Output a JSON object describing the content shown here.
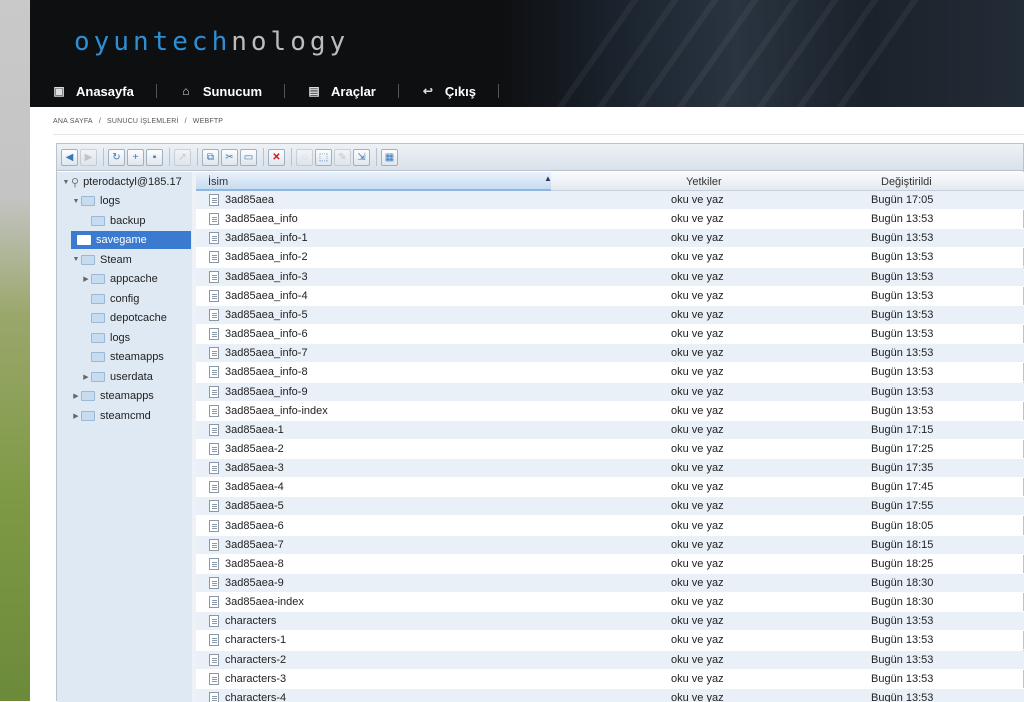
{
  "logo": {
    "part1": "oyuntech",
    "part2": "nology"
  },
  "nav": [
    {
      "label": "Anasayfa",
      "icon": "dashboard-icon"
    },
    {
      "label": "Sunucum",
      "icon": "server-icon"
    },
    {
      "label": "Araçlar",
      "icon": "tools-icon"
    },
    {
      "label": "Çıkış",
      "icon": "logout-icon"
    }
  ],
  "breadcrumb": [
    "ANA SAYFA",
    "SUNUCU İŞLEMLERİ",
    "WEBFTP"
  ],
  "tree": {
    "root": "pterodactyl@185.17",
    "items": [
      {
        "label": "logs",
        "level": 1,
        "expanded": true
      },
      {
        "label": "backup",
        "level": 2
      },
      {
        "label": "savegame",
        "level": 1,
        "selected": true
      },
      {
        "label": "Steam",
        "level": 1,
        "expanded": true
      },
      {
        "label": "appcache",
        "level": 2,
        "collapsed": true
      },
      {
        "label": "config",
        "level": 2
      },
      {
        "label": "depotcache",
        "level": 2
      },
      {
        "label": "logs",
        "level": 2
      },
      {
        "label": "steamapps",
        "level": 2
      },
      {
        "label": "userdata",
        "level": 2,
        "collapsed": true
      },
      {
        "label": "steamapps",
        "level": 1,
        "collapsed": true
      },
      {
        "label": "steamcmd",
        "level": 1,
        "collapsed": true
      }
    ]
  },
  "columns": {
    "name": "İsim",
    "perms": "Yetkiler",
    "modified": "Değiştirildi"
  },
  "files": [
    {
      "name": "3ad85aea",
      "perms": "oku ve yaz",
      "modified": "Bugün 17:05"
    },
    {
      "name": "3ad85aea_info",
      "perms": "oku ve yaz",
      "modified": "Bugün 13:53"
    },
    {
      "name": "3ad85aea_info-1",
      "perms": "oku ve yaz",
      "modified": "Bugün 13:53"
    },
    {
      "name": "3ad85aea_info-2",
      "perms": "oku ve yaz",
      "modified": "Bugün 13:53"
    },
    {
      "name": "3ad85aea_info-3",
      "perms": "oku ve yaz",
      "modified": "Bugün 13:53"
    },
    {
      "name": "3ad85aea_info-4",
      "perms": "oku ve yaz",
      "modified": "Bugün 13:53"
    },
    {
      "name": "3ad85aea_info-5",
      "perms": "oku ve yaz",
      "modified": "Bugün 13:53"
    },
    {
      "name": "3ad85aea_info-6",
      "perms": "oku ve yaz",
      "modified": "Bugün 13:53"
    },
    {
      "name": "3ad85aea_info-7",
      "perms": "oku ve yaz",
      "modified": "Bugün 13:53"
    },
    {
      "name": "3ad85aea_info-8",
      "perms": "oku ve yaz",
      "modified": "Bugün 13:53"
    },
    {
      "name": "3ad85aea_info-9",
      "perms": "oku ve yaz",
      "modified": "Bugün 13:53"
    },
    {
      "name": "3ad85aea_info-index",
      "perms": "oku ve yaz",
      "modified": "Bugün 13:53"
    },
    {
      "name": "3ad85aea-1",
      "perms": "oku ve yaz",
      "modified": "Bugün 17:15"
    },
    {
      "name": "3ad85aea-2",
      "perms": "oku ve yaz",
      "modified": "Bugün 17:25"
    },
    {
      "name": "3ad85aea-3",
      "perms": "oku ve yaz",
      "modified": "Bugün 17:35"
    },
    {
      "name": "3ad85aea-4",
      "perms": "oku ve yaz",
      "modified": "Bugün 17:45"
    },
    {
      "name": "3ad85aea-5",
      "perms": "oku ve yaz",
      "modified": "Bugün 17:55"
    },
    {
      "name": "3ad85aea-6",
      "perms": "oku ve yaz",
      "modified": "Bugün 18:05"
    },
    {
      "name": "3ad85aea-7",
      "perms": "oku ve yaz",
      "modified": "Bugün 18:15"
    },
    {
      "name": "3ad85aea-8",
      "perms": "oku ve yaz",
      "modified": "Bugün 18:25"
    },
    {
      "name": "3ad85aea-9",
      "perms": "oku ve yaz",
      "modified": "Bugün 18:30"
    },
    {
      "name": "3ad85aea-index",
      "perms": "oku ve yaz",
      "modified": "Bugün 18:30"
    },
    {
      "name": "characters",
      "perms": "oku ve yaz",
      "modified": "Bugün 13:53"
    },
    {
      "name": "characters-1",
      "perms": "oku ve yaz",
      "modified": "Bugün 13:53"
    },
    {
      "name": "characters-2",
      "perms": "oku ve yaz",
      "modified": "Bugün 13:53"
    },
    {
      "name": "characters-3",
      "perms": "oku ve yaz",
      "modified": "Bugün 13:53"
    },
    {
      "name": "characters-4",
      "perms": "oku ve yaz",
      "modified": "Bugün 13:53"
    }
  ],
  "colors": {
    "accent": "#3a7ad0",
    "logo_blue": "#2d8fd6",
    "header_bg": "#0e0f11",
    "row_alt": "#e9f0f8",
    "delete_red": "#c8161d"
  }
}
